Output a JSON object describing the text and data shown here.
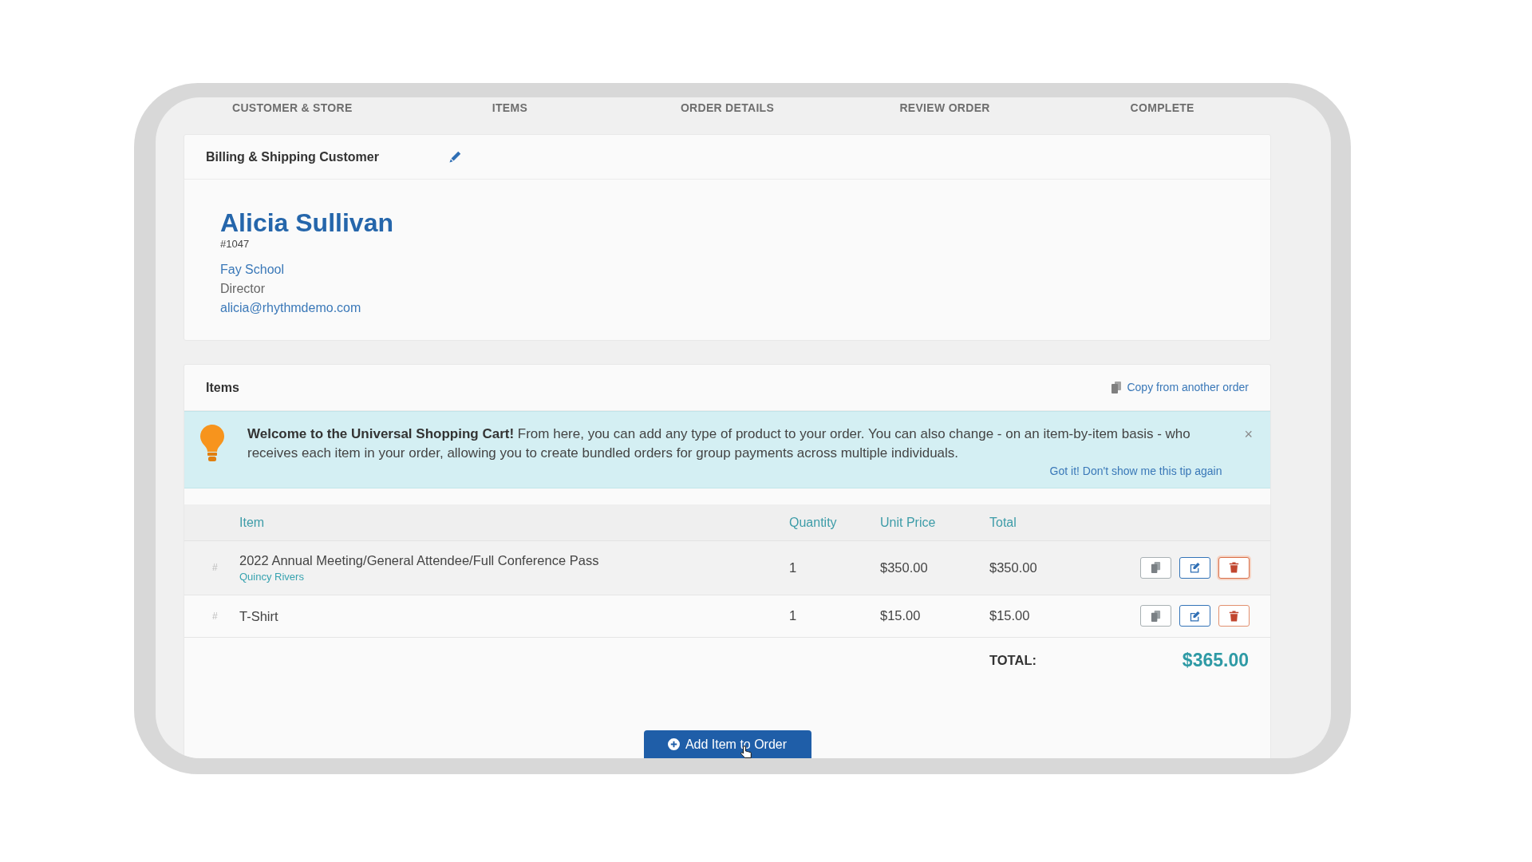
{
  "steps": [
    {
      "label": "CUSTOMER & STORE"
    },
    {
      "label": "ITEMS"
    },
    {
      "label": "ORDER DETAILS"
    },
    {
      "label": "REVIEW ORDER"
    },
    {
      "label": "COMPLETE"
    }
  ],
  "customer_card": {
    "title": "Billing & Shipping Customer",
    "name": "Alicia Sullivan",
    "number": "#1047",
    "organization": "Fay School",
    "role": "Director",
    "email": "alicia@rhythmdemo.com"
  },
  "items_card": {
    "title": "Items",
    "copy_link": "Copy from another order",
    "tip": {
      "message": "**Welcome to the Universal Shopping Cart!** From here, you can add any type of product to your order. You can also change - on an item-by-item basis - who receives each item in your order, allowing you to create bundled orders for group payments across multiple individuals.",
      "dismiss_link": "Got it! Don't show me this tip again",
      "close": "×"
    },
    "table": {
      "columns": [
        "Item",
        "Quantity",
        "Unit Price",
        "Total"
      ],
      "rows": [
        {
          "handle": "#",
          "item": "2022 Annual Meeting/General Attendee/Full Conference Pass",
          "recipient": "Quincy Rivers",
          "quantity": "1",
          "unit_price": "$350.00",
          "total": "$350.00",
          "highlighted": true
        },
        {
          "handle": "#",
          "item": "T-Shirt",
          "quantity": "1",
          "unit_price": "$15.00",
          "total": "$15.00",
          "highlighted": false
        }
      ]
    },
    "total_label": "TOTAL:",
    "total": "$365.00",
    "add_button": "Add Item to Order"
  }
}
